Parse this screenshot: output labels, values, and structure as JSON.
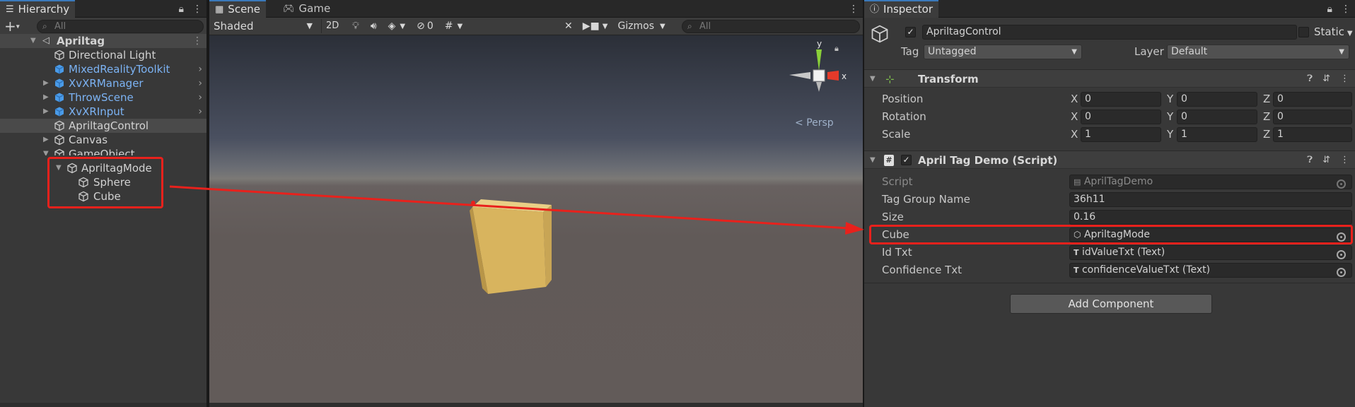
{
  "hierarchy": {
    "tab_label": "Hierarchy",
    "add_label": "+",
    "search_placeholder": "All",
    "scene_name": "Apriltag",
    "items": [
      {
        "label": "Directional Light"
      },
      {
        "label": "MixedRealityToolkit"
      },
      {
        "label": "XvXRManager"
      },
      {
        "label": "ThrowScene"
      },
      {
        "label": "XvXRInput"
      },
      {
        "label": "ApriltagControl"
      },
      {
        "label": "Canvas"
      },
      {
        "label": "GameObject"
      },
      {
        "label": "ApriltagMode"
      },
      {
        "label": "Sphere"
      },
      {
        "label": "Cube"
      }
    ]
  },
  "scene": {
    "tabs": [
      {
        "label": "Scene"
      },
      {
        "label": "Game"
      }
    ],
    "shading_mode": "Shaded",
    "two_d_label": "2D",
    "hidden_count": "0",
    "gizmos_label": "Gizmos",
    "search_placeholder": "All",
    "axis_x": "x",
    "axis_y": "y",
    "projection_label": "Persp"
  },
  "inspector": {
    "tab_label": "Inspector",
    "object_name": "ApriltagControl",
    "static_label": "Static",
    "tag_label": "Tag",
    "tag_value": "Untagged",
    "layer_label": "Layer",
    "layer_value": "Default",
    "transform": {
      "title": "Transform",
      "rows": [
        {
          "label": "Position",
          "x": "0",
          "y": "0",
          "z": "0"
        },
        {
          "label": "Rotation",
          "x": "0",
          "y": "0",
          "z": "0"
        },
        {
          "label": "Scale",
          "x": "1",
          "y": "1",
          "z": "1"
        }
      ],
      "axis_labels": [
        "X",
        "Y",
        "Z"
      ]
    },
    "script_component": {
      "title": "April Tag Demo (Script)",
      "fields": [
        {
          "label": "Script",
          "value": "AprilTagDemo"
        },
        {
          "label": "Tag Group Name",
          "value": "36h11"
        },
        {
          "label": "Size",
          "value": "0.16"
        },
        {
          "label": "Cube",
          "value": "ApriltagMode"
        },
        {
          "label": "Id Txt",
          "value": "idValueTxt (Text)"
        },
        {
          "label": "Confidence Txt",
          "value": "confidenceValueTxt (Text)"
        }
      ]
    },
    "add_component_label": "Add Component"
  },
  "colors": {
    "highlight_red": "#e8211c",
    "prefab_blue": "#7cb3f4",
    "cube_yellow": "#d8b45e"
  }
}
